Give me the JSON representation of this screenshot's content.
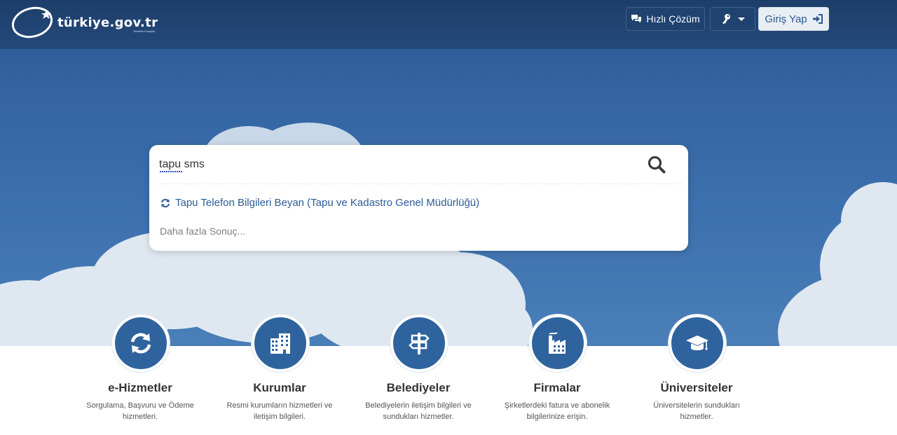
{
  "header": {
    "logo_text": "türkiye.gov.tr",
    "logo_tagline": "Devletin Kısayolu",
    "hizli_cozum_label": "Hızlı Çözüm",
    "giris_label": "Giriş Yap"
  },
  "search": {
    "value": "tapu sms",
    "suggestion": "Tapu Telefon Bilgileri Beyan (Tapu ve Kadastro Genel Müdürlüğü)",
    "more_results": "Daha fazla Sonuç..."
  },
  "categories": [
    {
      "icon": "refresh-icon",
      "title": "e-Hizmetler",
      "desc_line1": "Sorgulama, Başvuru ve Ödeme",
      "desc_line2": "hizmetleri."
    },
    {
      "icon": "building-icon",
      "title": "Kurumlar",
      "desc_line1": "Resmi kurumların hizmetleri ve",
      "desc_line2": "iletişim bilgileri."
    },
    {
      "icon": "signpost-icon",
      "title": "Belediyeler",
      "desc_line1": "Belediyelerin iletişim bilgileri ve",
      "desc_line2": "sundukları hizmetler."
    },
    {
      "icon": "factory-icon",
      "title": "Firmalar",
      "desc_line1": "Şirketlerdeki fatura ve abonelik",
      "desc_line2": "bilgilerinize erişin."
    },
    {
      "icon": "graduation-cap-icon",
      "title": "Üniversiteler",
      "desc_line1": "Üniversitelerin sundukları",
      "desc_line2": "hizmetler."
    }
  ],
  "colors": {
    "topbar": "#1d3e6a",
    "accent": "#2f639d",
    "link": "#2c5c95"
  }
}
